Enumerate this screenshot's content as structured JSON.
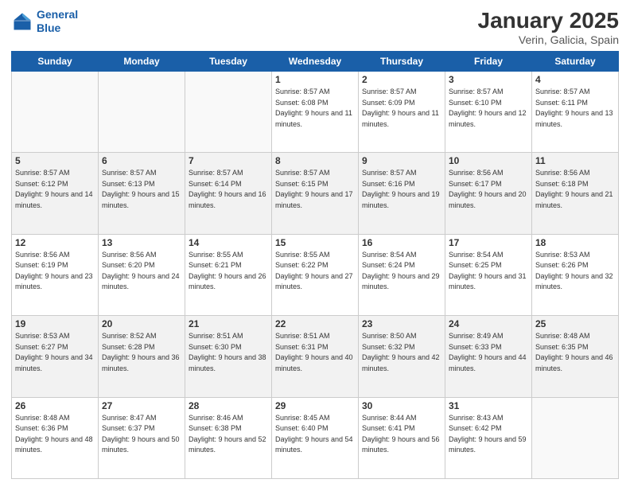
{
  "header": {
    "logo_line1": "General",
    "logo_line2": "Blue",
    "title": "January 2025",
    "subtitle": "Verin, Galicia, Spain"
  },
  "weekdays": [
    "Sunday",
    "Monday",
    "Tuesday",
    "Wednesday",
    "Thursday",
    "Friday",
    "Saturday"
  ],
  "weeks": [
    [
      {
        "day": "",
        "sunrise": "",
        "sunset": "",
        "daylight": "",
        "empty": true
      },
      {
        "day": "",
        "sunrise": "",
        "sunset": "",
        "daylight": "",
        "empty": true
      },
      {
        "day": "",
        "sunrise": "",
        "sunset": "",
        "daylight": "",
        "empty": true
      },
      {
        "day": "1",
        "sunrise": "Sunrise: 8:57 AM",
        "sunset": "Sunset: 6:08 PM",
        "daylight": "Daylight: 9 hours and 11 minutes."
      },
      {
        "day": "2",
        "sunrise": "Sunrise: 8:57 AM",
        "sunset": "Sunset: 6:09 PM",
        "daylight": "Daylight: 9 hours and 11 minutes."
      },
      {
        "day": "3",
        "sunrise": "Sunrise: 8:57 AM",
        "sunset": "Sunset: 6:10 PM",
        "daylight": "Daylight: 9 hours and 12 minutes."
      },
      {
        "day": "4",
        "sunrise": "Sunrise: 8:57 AM",
        "sunset": "Sunset: 6:11 PM",
        "daylight": "Daylight: 9 hours and 13 minutes."
      }
    ],
    [
      {
        "day": "5",
        "sunrise": "Sunrise: 8:57 AM",
        "sunset": "Sunset: 6:12 PM",
        "daylight": "Daylight: 9 hours and 14 minutes."
      },
      {
        "day": "6",
        "sunrise": "Sunrise: 8:57 AM",
        "sunset": "Sunset: 6:13 PM",
        "daylight": "Daylight: 9 hours and 15 minutes."
      },
      {
        "day": "7",
        "sunrise": "Sunrise: 8:57 AM",
        "sunset": "Sunset: 6:14 PM",
        "daylight": "Daylight: 9 hours and 16 minutes."
      },
      {
        "day": "8",
        "sunrise": "Sunrise: 8:57 AM",
        "sunset": "Sunset: 6:15 PM",
        "daylight": "Daylight: 9 hours and 17 minutes."
      },
      {
        "day": "9",
        "sunrise": "Sunrise: 8:57 AM",
        "sunset": "Sunset: 6:16 PM",
        "daylight": "Daylight: 9 hours and 19 minutes."
      },
      {
        "day": "10",
        "sunrise": "Sunrise: 8:56 AM",
        "sunset": "Sunset: 6:17 PM",
        "daylight": "Daylight: 9 hours and 20 minutes."
      },
      {
        "day": "11",
        "sunrise": "Sunrise: 8:56 AM",
        "sunset": "Sunset: 6:18 PM",
        "daylight": "Daylight: 9 hours and 21 minutes."
      }
    ],
    [
      {
        "day": "12",
        "sunrise": "Sunrise: 8:56 AM",
        "sunset": "Sunset: 6:19 PM",
        "daylight": "Daylight: 9 hours and 23 minutes."
      },
      {
        "day": "13",
        "sunrise": "Sunrise: 8:56 AM",
        "sunset": "Sunset: 6:20 PM",
        "daylight": "Daylight: 9 hours and 24 minutes."
      },
      {
        "day": "14",
        "sunrise": "Sunrise: 8:55 AM",
        "sunset": "Sunset: 6:21 PM",
        "daylight": "Daylight: 9 hours and 26 minutes."
      },
      {
        "day": "15",
        "sunrise": "Sunrise: 8:55 AM",
        "sunset": "Sunset: 6:22 PM",
        "daylight": "Daylight: 9 hours and 27 minutes."
      },
      {
        "day": "16",
        "sunrise": "Sunrise: 8:54 AM",
        "sunset": "Sunset: 6:24 PM",
        "daylight": "Daylight: 9 hours and 29 minutes."
      },
      {
        "day": "17",
        "sunrise": "Sunrise: 8:54 AM",
        "sunset": "Sunset: 6:25 PM",
        "daylight": "Daylight: 9 hours and 31 minutes."
      },
      {
        "day": "18",
        "sunrise": "Sunrise: 8:53 AM",
        "sunset": "Sunset: 6:26 PM",
        "daylight": "Daylight: 9 hours and 32 minutes."
      }
    ],
    [
      {
        "day": "19",
        "sunrise": "Sunrise: 8:53 AM",
        "sunset": "Sunset: 6:27 PM",
        "daylight": "Daylight: 9 hours and 34 minutes."
      },
      {
        "day": "20",
        "sunrise": "Sunrise: 8:52 AM",
        "sunset": "Sunset: 6:28 PM",
        "daylight": "Daylight: 9 hours and 36 minutes."
      },
      {
        "day": "21",
        "sunrise": "Sunrise: 8:51 AM",
        "sunset": "Sunset: 6:30 PM",
        "daylight": "Daylight: 9 hours and 38 minutes."
      },
      {
        "day": "22",
        "sunrise": "Sunrise: 8:51 AM",
        "sunset": "Sunset: 6:31 PM",
        "daylight": "Daylight: 9 hours and 40 minutes."
      },
      {
        "day": "23",
        "sunrise": "Sunrise: 8:50 AM",
        "sunset": "Sunset: 6:32 PM",
        "daylight": "Daylight: 9 hours and 42 minutes."
      },
      {
        "day": "24",
        "sunrise": "Sunrise: 8:49 AM",
        "sunset": "Sunset: 6:33 PM",
        "daylight": "Daylight: 9 hours and 44 minutes."
      },
      {
        "day": "25",
        "sunrise": "Sunrise: 8:48 AM",
        "sunset": "Sunset: 6:35 PM",
        "daylight": "Daylight: 9 hours and 46 minutes."
      }
    ],
    [
      {
        "day": "26",
        "sunrise": "Sunrise: 8:48 AM",
        "sunset": "Sunset: 6:36 PM",
        "daylight": "Daylight: 9 hours and 48 minutes."
      },
      {
        "day": "27",
        "sunrise": "Sunrise: 8:47 AM",
        "sunset": "Sunset: 6:37 PM",
        "daylight": "Daylight: 9 hours and 50 minutes."
      },
      {
        "day": "28",
        "sunrise": "Sunrise: 8:46 AM",
        "sunset": "Sunset: 6:38 PM",
        "daylight": "Daylight: 9 hours and 52 minutes."
      },
      {
        "day": "29",
        "sunrise": "Sunrise: 8:45 AM",
        "sunset": "Sunset: 6:40 PM",
        "daylight": "Daylight: 9 hours and 54 minutes."
      },
      {
        "day": "30",
        "sunrise": "Sunrise: 8:44 AM",
        "sunset": "Sunset: 6:41 PM",
        "daylight": "Daylight: 9 hours and 56 minutes."
      },
      {
        "day": "31",
        "sunrise": "Sunrise: 8:43 AM",
        "sunset": "Sunset: 6:42 PM",
        "daylight": "Daylight: 9 hours and 59 minutes."
      },
      {
        "day": "",
        "sunrise": "",
        "sunset": "",
        "daylight": "",
        "empty": true
      }
    ]
  ]
}
